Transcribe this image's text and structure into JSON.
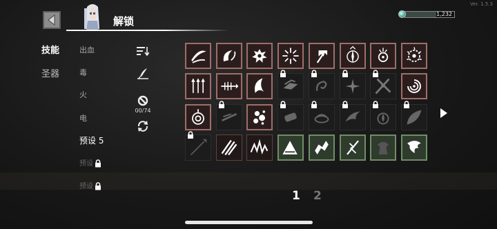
{
  "version": "Ver. 1.5.3",
  "header": {
    "title": "解锁"
  },
  "currency": {
    "value": "1,232",
    "icon": "gem-icon"
  },
  "tabs": [
    {
      "label": "技能",
      "active": true
    },
    {
      "label": "圣器",
      "active": false
    }
  ],
  "categories": [
    {
      "label": "出血",
      "state": "normal"
    },
    {
      "label": "毒",
      "state": "normal"
    },
    {
      "label": "火",
      "state": "normal"
    },
    {
      "label": "电",
      "state": "normal"
    },
    {
      "label": "预设 5",
      "state": "selected"
    },
    {
      "label": "预设",
      "state": "locked"
    },
    {
      "label": "预设",
      "state": "locked"
    }
  ],
  "tools": {
    "sort_icon": "sort-icon",
    "edit_icon": "quill-icon",
    "ban_icon": "ban-icon",
    "refresh_icon": "refresh-icon",
    "ban_count": "00/74"
  },
  "skills": [
    {
      "icon": "slash-arc",
      "style": "red",
      "locked": false
    },
    {
      "icon": "swirl-blade",
      "style": "red",
      "locked": false
    },
    {
      "icon": "splatter",
      "style": "red",
      "locked": false
    },
    {
      "icon": "burst",
      "style": "red",
      "locked": false
    },
    {
      "icon": "trident",
      "style": "red",
      "locked": false
    },
    {
      "icon": "compass",
      "style": "red",
      "locked": false
    },
    {
      "icon": "orb-spikes",
      "style": "red",
      "locked": false
    },
    {
      "icon": "thorn-ring",
      "style": "red",
      "locked": false
    },
    {
      "icon": "arrows",
      "style": "red",
      "locked": false
    },
    {
      "icon": "fish-bone",
      "style": "red",
      "locked": false
    },
    {
      "icon": "crescent",
      "style": "red",
      "locked": false
    },
    {
      "icon": "feathers",
      "style": "dark",
      "locked": true
    },
    {
      "icon": "curl",
      "style": "dark",
      "locked": true
    },
    {
      "icon": "star-blade",
      "style": "dark",
      "locked": true
    },
    {
      "icon": "crossed-blades",
      "style": "dark",
      "locked": true
    },
    {
      "icon": "vortex",
      "style": "red",
      "locked": false
    },
    {
      "icon": "target-orb",
      "style": "red",
      "locked": false
    },
    {
      "icon": "dash",
      "style": "dark",
      "locked": true
    },
    {
      "icon": "splash",
      "style": "red",
      "locked": false
    },
    {
      "icon": "ammo",
      "style": "dark",
      "locked": true
    },
    {
      "icon": "coil",
      "style": "dark",
      "locked": true
    },
    {
      "icon": "wing",
      "style": "dark",
      "locked": true
    },
    {
      "icon": "flame-orb",
      "style": "dark",
      "locked": true
    },
    {
      "icon": "leaf",
      "style": "dark",
      "locked": true
    },
    {
      "icon": "spear",
      "style": "dark",
      "locked": true
    },
    {
      "icon": "claw",
      "style": "redd",
      "locked": false
    },
    {
      "icon": "zigzag",
      "style": "redd",
      "locked": false
    },
    {
      "icon": "shockwave",
      "style": "green",
      "locked": false
    },
    {
      "icon": "chain",
      "style": "green",
      "locked": false
    },
    {
      "icon": "lightning-sword",
      "style": "green",
      "locked": false
    },
    {
      "icon": "golem",
      "style": "green",
      "locked": false
    },
    {
      "icon": "tornado-fist",
      "style": "green",
      "locked": false
    }
  ],
  "pagination": {
    "pages": [
      "1",
      "2"
    ],
    "current": "1"
  }
}
